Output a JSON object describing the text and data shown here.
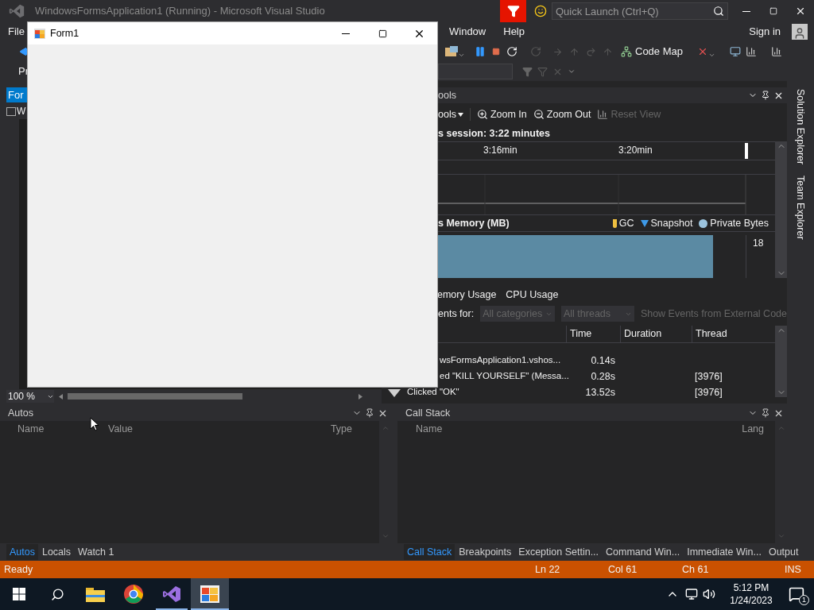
{
  "vs_window": {
    "title": "WindowsFormsApplication1 (Running) - Microsoft Visual Studio",
    "quick_launch": {
      "placeholder": "Quick Launch (Ctrl+Q)"
    }
  },
  "menu": {
    "left": [
      "File"
    ],
    "right": [
      "Window",
      "Help"
    ],
    "sign_in": "Sign in"
  },
  "toolbar": {
    "code_map": "Code Map"
  },
  "toolbar2": {
    "label": "Pr"
  },
  "editor": {
    "tab": {
      "label": "For",
      "selected": true
    },
    "file": "W",
    "zoom": "100 %"
  },
  "diagnostics": {
    "title": "ools",
    "tools_menu": "ools",
    "zoom_in": "Zoom In",
    "zoom_out": "Zoom Out",
    "reset_view": {
      "label": "Reset View",
      "disabled": true
    },
    "session": "s session: 3:22 minutes",
    "ruler": [
      "3:16min",
      "3:20min"
    ],
    "memory_title": "s Memory (MB)",
    "legend": [
      {
        "label": "GC",
        "kind": "marker",
        "color": "#f0c040"
      },
      {
        "label": "Snapshot",
        "kind": "triangle",
        "color": "#3e9ae8"
      },
      {
        "label": "Private Bytes",
        "kind": "dot",
        "color": "#9cc4de"
      }
    ],
    "axis_max": "18",
    "tabs": [
      {
        "label": "emory Usage",
        "selected": false
      },
      {
        "label": "CPU Usage",
        "selected": false
      }
    ],
    "filter_label": "ents for:",
    "filters": [
      {
        "value": "All categories",
        "disabled": true
      },
      {
        "value": "All threads",
        "disabled": true
      }
    ],
    "external_code": {
      "label": "Show Events from External Code",
      "disabled": true
    },
    "columns": [
      "Time",
      "Duration",
      "Thread"
    ],
    "rows": [
      {
        "event": "wsFormsApplication1.vshos...",
        "time": "0.14s",
        "marker": false
      },
      {
        "event": "ed \"KILL YOURSELF\" (Messa...",
        "time": "0.28s",
        "thread": "[3976]",
        "marker": false
      },
      {
        "event": "Clicked \"OK\"",
        "time": "13.52s",
        "thread": "[3976]",
        "marker": true
      }
    ]
  },
  "side_tabs": [
    "Solution Explorer",
    "Team Explorer"
  ],
  "autos": {
    "title": "Autos",
    "columns": [
      "Name",
      "Value",
      "Type"
    ],
    "tabs": [
      {
        "label": "Autos",
        "selected": true
      },
      {
        "label": "Locals",
        "selected": false
      },
      {
        "label": "Watch 1",
        "selected": false
      }
    ]
  },
  "call_stack": {
    "title": "Call Stack",
    "columns": [
      "Name",
      "Lang"
    ],
    "tabs": [
      {
        "label": "Call Stack",
        "selected": true
      },
      {
        "label": "Breakpoints",
        "selected": false
      },
      {
        "label": "Exception Settin...",
        "selected": false
      },
      {
        "label": "Command Win...",
        "selected": false
      },
      {
        "label": "Immediate Win...",
        "selected": false
      },
      {
        "label": "Output",
        "selected": false
      }
    ]
  },
  "status_bar": {
    "left": "Ready",
    "items": [
      "Ln 22",
      "Col 61",
      "Ch 61",
      "INS"
    ]
  },
  "form": {
    "title": "Form1"
  },
  "taskbar": {
    "apps": [
      {
        "kind": "explorer",
        "selected": false,
        "running": false
      },
      {
        "kind": "chrome",
        "selected": false,
        "running": false
      },
      {
        "kind": "vs",
        "selected": false,
        "running": true
      },
      {
        "kind": "form",
        "selected": true,
        "running": true
      }
    ],
    "time": "5:12 PM",
    "date": "1/24/2023",
    "notifications": "1"
  }
}
